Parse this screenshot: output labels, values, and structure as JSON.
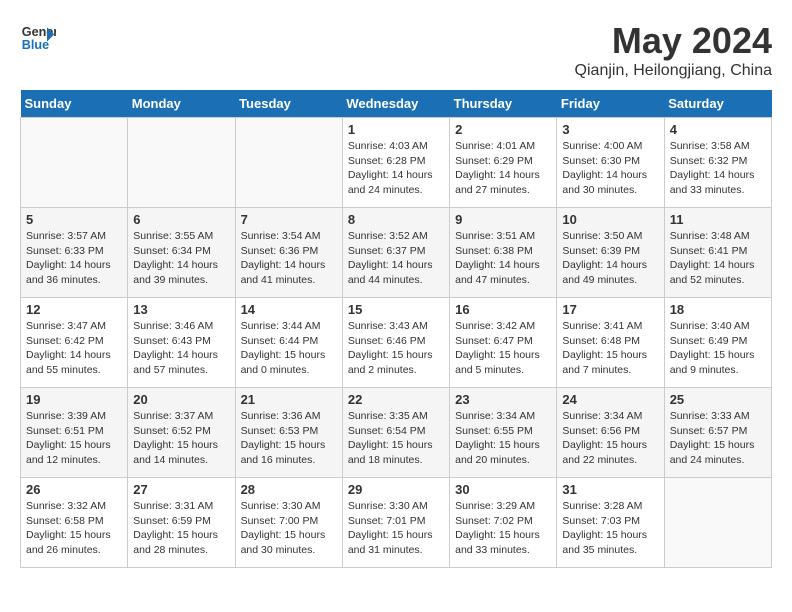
{
  "header": {
    "logo_line1": "General",
    "logo_line2": "Blue",
    "title": "May 2024",
    "subtitle": "Qianjin, Heilongjiang, China"
  },
  "days_of_week": [
    "Sunday",
    "Monday",
    "Tuesday",
    "Wednesday",
    "Thursday",
    "Friday",
    "Saturday"
  ],
  "weeks": [
    [
      {
        "num": "",
        "info": ""
      },
      {
        "num": "",
        "info": ""
      },
      {
        "num": "",
        "info": ""
      },
      {
        "num": "1",
        "info": "Sunrise: 4:03 AM\nSunset: 6:28 PM\nDaylight: 14 hours\nand 24 minutes."
      },
      {
        "num": "2",
        "info": "Sunrise: 4:01 AM\nSunset: 6:29 PM\nDaylight: 14 hours\nand 27 minutes."
      },
      {
        "num": "3",
        "info": "Sunrise: 4:00 AM\nSunset: 6:30 PM\nDaylight: 14 hours\nand 30 minutes."
      },
      {
        "num": "4",
        "info": "Sunrise: 3:58 AM\nSunset: 6:32 PM\nDaylight: 14 hours\nand 33 minutes."
      }
    ],
    [
      {
        "num": "5",
        "info": "Sunrise: 3:57 AM\nSunset: 6:33 PM\nDaylight: 14 hours\nand 36 minutes."
      },
      {
        "num": "6",
        "info": "Sunrise: 3:55 AM\nSunset: 6:34 PM\nDaylight: 14 hours\nand 39 minutes."
      },
      {
        "num": "7",
        "info": "Sunrise: 3:54 AM\nSunset: 6:36 PM\nDaylight: 14 hours\nand 41 minutes."
      },
      {
        "num": "8",
        "info": "Sunrise: 3:52 AM\nSunset: 6:37 PM\nDaylight: 14 hours\nand 44 minutes."
      },
      {
        "num": "9",
        "info": "Sunrise: 3:51 AM\nSunset: 6:38 PM\nDaylight: 14 hours\nand 47 minutes."
      },
      {
        "num": "10",
        "info": "Sunrise: 3:50 AM\nSunset: 6:39 PM\nDaylight: 14 hours\nand 49 minutes."
      },
      {
        "num": "11",
        "info": "Sunrise: 3:48 AM\nSunset: 6:41 PM\nDaylight: 14 hours\nand 52 minutes."
      }
    ],
    [
      {
        "num": "12",
        "info": "Sunrise: 3:47 AM\nSunset: 6:42 PM\nDaylight: 14 hours\nand 55 minutes."
      },
      {
        "num": "13",
        "info": "Sunrise: 3:46 AM\nSunset: 6:43 PM\nDaylight: 14 hours\nand 57 minutes."
      },
      {
        "num": "14",
        "info": "Sunrise: 3:44 AM\nSunset: 6:44 PM\nDaylight: 15 hours\nand 0 minutes."
      },
      {
        "num": "15",
        "info": "Sunrise: 3:43 AM\nSunset: 6:46 PM\nDaylight: 15 hours\nand 2 minutes."
      },
      {
        "num": "16",
        "info": "Sunrise: 3:42 AM\nSunset: 6:47 PM\nDaylight: 15 hours\nand 5 minutes."
      },
      {
        "num": "17",
        "info": "Sunrise: 3:41 AM\nSunset: 6:48 PM\nDaylight: 15 hours\nand 7 minutes."
      },
      {
        "num": "18",
        "info": "Sunrise: 3:40 AM\nSunset: 6:49 PM\nDaylight: 15 hours\nand 9 minutes."
      }
    ],
    [
      {
        "num": "19",
        "info": "Sunrise: 3:39 AM\nSunset: 6:51 PM\nDaylight: 15 hours\nand 12 minutes."
      },
      {
        "num": "20",
        "info": "Sunrise: 3:37 AM\nSunset: 6:52 PM\nDaylight: 15 hours\nand 14 minutes."
      },
      {
        "num": "21",
        "info": "Sunrise: 3:36 AM\nSunset: 6:53 PM\nDaylight: 15 hours\nand 16 minutes."
      },
      {
        "num": "22",
        "info": "Sunrise: 3:35 AM\nSunset: 6:54 PM\nDaylight: 15 hours\nand 18 minutes."
      },
      {
        "num": "23",
        "info": "Sunrise: 3:34 AM\nSunset: 6:55 PM\nDaylight: 15 hours\nand 20 minutes."
      },
      {
        "num": "24",
        "info": "Sunrise: 3:34 AM\nSunset: 6:56 PM\nDaylight: 15 hours\nand 22 minutes."
      },
      {
        "num": "25",
        "info": "Sunrise: 3:33 AM\nSunset: 6:57 PM\nDaylight: 15 hours\nand 24 minutes."
      }
    ],
    [
      {
        "num": "26",
        "info": "Sunrise: 3:32 AM\nSunset: 6:58 PM\nDaylight: 15 hours\nand 26 minutes."
      },
      {
        "num": "27",
        "info": "Sunrise: 3:31 AM\nSunset: 6:59 PM\nDaylight: 15 hours\nand 28 minutes."
      },
      {
        "num": "28",
        "info": "Sunrise: 3:30 AM\nSunset: 7:00 PM\nDaylight: 15 hours\nand 30 minutes."
      },
      {
        "num": "29",
        "info": "Sunrise: 3:30 AM\nSunset: 7:01 PM\nDaylight: 15 hours\nand 31 minutes."
      },
      {
        "num": "30",
        "info": "Sunrise: 3:29 AM\nSunset: 7:02 PM\nDaylight: 15 hours\nand 33 minutes."
      },
      {
        "num": "31",
        "info": "Sunrise: 3:28 AM\nSunset: 7:03 PM\nDaylight: 15 hours\nand 35 minutes."
      },
      {
        "num": "",
        "info": ""
      }
    ]
  ]
}
